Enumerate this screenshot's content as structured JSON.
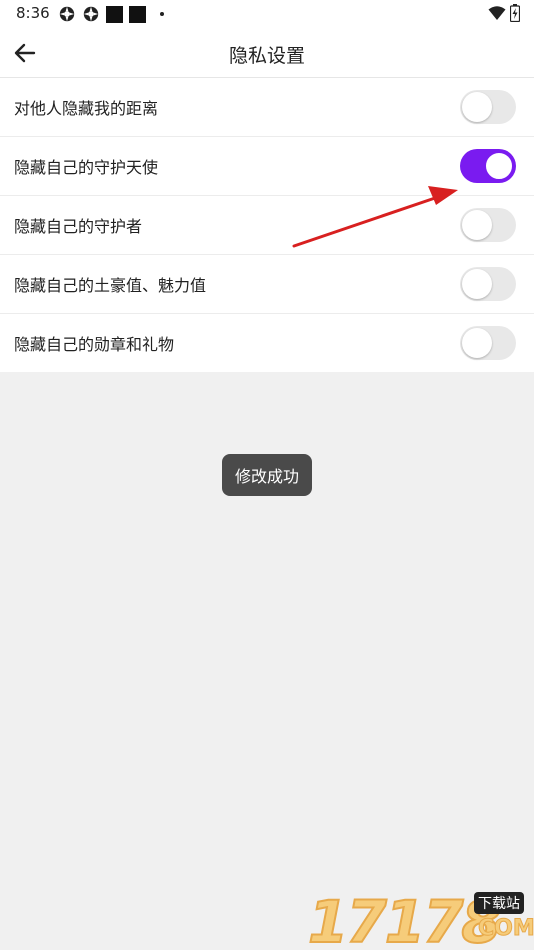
{
  "status_bar": {
    "time": "8:36",
    "icons": [
      "settings-icon",
      "settings-icon",
      "square-icon",
      "square-icon",
      "dot-icon",
      "wifi-icon",
      "battery-icon"
    ]
  },
  "header": {
    "title": "隐私设置",
    "back_icon": "arrow-left-icon"
  },
  "settings": [
    {
      "label": "对他人隐藏我的距离",
      "on": false
    },
    {
      "label": "隐藏自己的守护天使",
      "on": true
    },
    {
      "label": "隐藏自己的守护者",
      "on": false
    },
    {
      "label": "隐藏自己的土豪值、魅力值",
      "on": false
    },
    {
      "label": "隐藏自己的勋章和礼物",
      "on": false
    }
  ],
  "toast": {
    "text": "修改成功"
  },
  "watermark": {
    "number": "17178",
    "tag": "下载站",
    "suffix": "COM"
  },
  "colors": {
    "accent": "#7a1bf0",
    "arrow": "#d82020",
    "background": "#f0f0f0"
  }
}
